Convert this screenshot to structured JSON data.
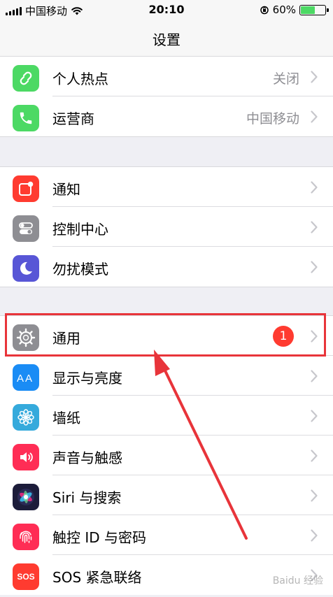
{
  "status_bar": {
    "carrier": "中国移动",
    "time": "20:10",
    "battery_percent": "60%",
    "battery_level": 0.6
  },
  "nav": {
    "title": "设置"
  },
  "groups": [
    {
      "rows": [
        {
          "label": "个人热点",
          "value": "关闭",
          "icon": "personal-hotspot-icon",
          "color": "#4cd964"
        },
        {
          "label": "运营商",
          "value": "中国移动",
          "icon": "phone-icon",
          "color": "#4cd964"
        }
      ]
    },
    {
      "rows": [
        {
          "label": "通知",
          "icon": "notifications-icon",
          "color": "#ff3b30"
        },
        {
          "label": "控制中心",
          "icon": "control-center-icon",
          "color": "#8e8e93"
        },
        {
          "label": "勿扰模式",
          "icon": "moon-icon",
          "color": "#5856d6"
        }
      ]
    },
    {
      "rows": [
        {
          "label": "通用",
          "badge": "1",
          "icon": "gear-icon",
          "color": "#8e8e93"
        },
        {
          "label": "显示与亮度",
          "icon": "display-aa-icon",
          "color": "#1a8cf5"
        },
        {
          "label": "墙纸",
          "icon": "wallpaper-flower-icon",
          "color": "#35aadc"
        },
        {
          "label": "声音与触感",
          "icon": "speaker-icon",
          "color": "#ff2d55"
        },
        {
          "label": "Siri 与搜索",
          "icon": "siri-icon",
          "color": "#1c1c3a"
        },
        {
          "label": "触控 ID 与密码",
          "icon": "fingerprint-icon",
          "color": "#ff2d55"
        },
        {
          "label": "SOS 紧急联络",
          "icon_text": "SOS",
          "icon": "sos-icon",
          "color": "#ff3b30"
        }
      ]
    }
  ],
  "watermark": "Baidu 经验"
}
